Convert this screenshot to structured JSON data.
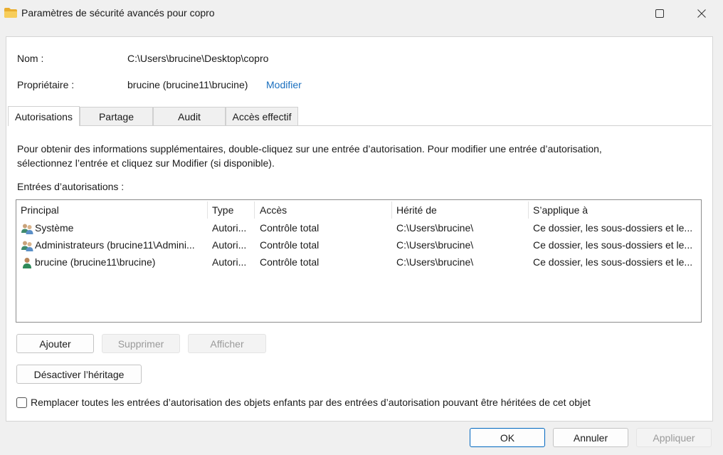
{
  "window": {
    "title": "Paramètres de sécurité avancés pour copro",
    "icon": "folder-icon",
    "controls": [
      "maximize-icon",
      "close-icon"
    ]
  },
  "info": {
    "name_label": "Nom :",
    "name_value": "C:\\Users\\brucine\\Desktop\\copro",
    "owner_label": "Propriétaire :",
    "owner_value": "brucine (brucine11\\brucine)",
    "owner_change_link": "Modifier"
  },
  "tabs": [
    {
      "label": "Autorisations",
      "active": true
    },
    {
      "label": "Partage",
      "active": false
    },
    {
      "label": "Audit",
      "active": false
    },
    {
      "label": "Accès effectif",
      "active": false
    }
  ],
  "permissions": {
    "description_line1": "Pour obtenir des informations supplémentaires, double-cliquez sur une entrée d’autorisation. Pour modifier une entrée d’autorisation,",
    "description_line2": "sélectionnez l’entrée et cliquez sur Modifier (si disponible).",
    "entries_label": "Entrées d’autorisations :",
    "columns": [
      "Principal",
      "Type",
      "Accès",
      "Hérité de",
      "S’applique à"
    ],
    "rows": [
      {
        "principal": "Système",
        "type": "Autori...",
        "access": "Contrôle total",
        "inherited_from": "C:\\Users\\brucine\\",
        "applies_to": "Ce dossier, les sous-dossiers et le...",
        "icon": "users-group-icon"
      },
      {
        "principal": "Administrateurs (brucine11\\Admini...",
        "type": "Autori...",
        "access": "Contrôle total",
        "inherited_from": "C:\\Users\\brucine\\",
        "applies_to": "Ce dossier, les sous-dossiers et le...",
        "icon": "users-group-icon"
      },
      {
        "principal": "brucine (brucine11\\brucine)",
        "type": "Autori...",
        "access": "Contrôle total",
        "inherited_from": "C:\\Users\\brucine\\",
        "applies_to": "Ce dossier, les sous-dossiers et le...",
        "icon": "user-icon"
      }
    ]
  },
  "actions": {
    "add": "Ajouter",
    "remove": "Supprimer",
    "view": "Afficher",
    "disable_inheritance": "Désactiver l’héritage",
    "replace_checkbox_label": "Remplacer toutes les entrées d’autorisation des objets enfants par des entrées d’autorisation pouvant être héritées de cet objet",
    "replace_checked": false
  },
  "footer": {
    "ok": "OK",
    "cancel": "Annuler",
    "apply": "Appliquer"
  },
  "colors": {
    "link": "#1a6fbf",
    "primary_border": "#0067c0",
    "folder": "#f2c14e"
  }
}
